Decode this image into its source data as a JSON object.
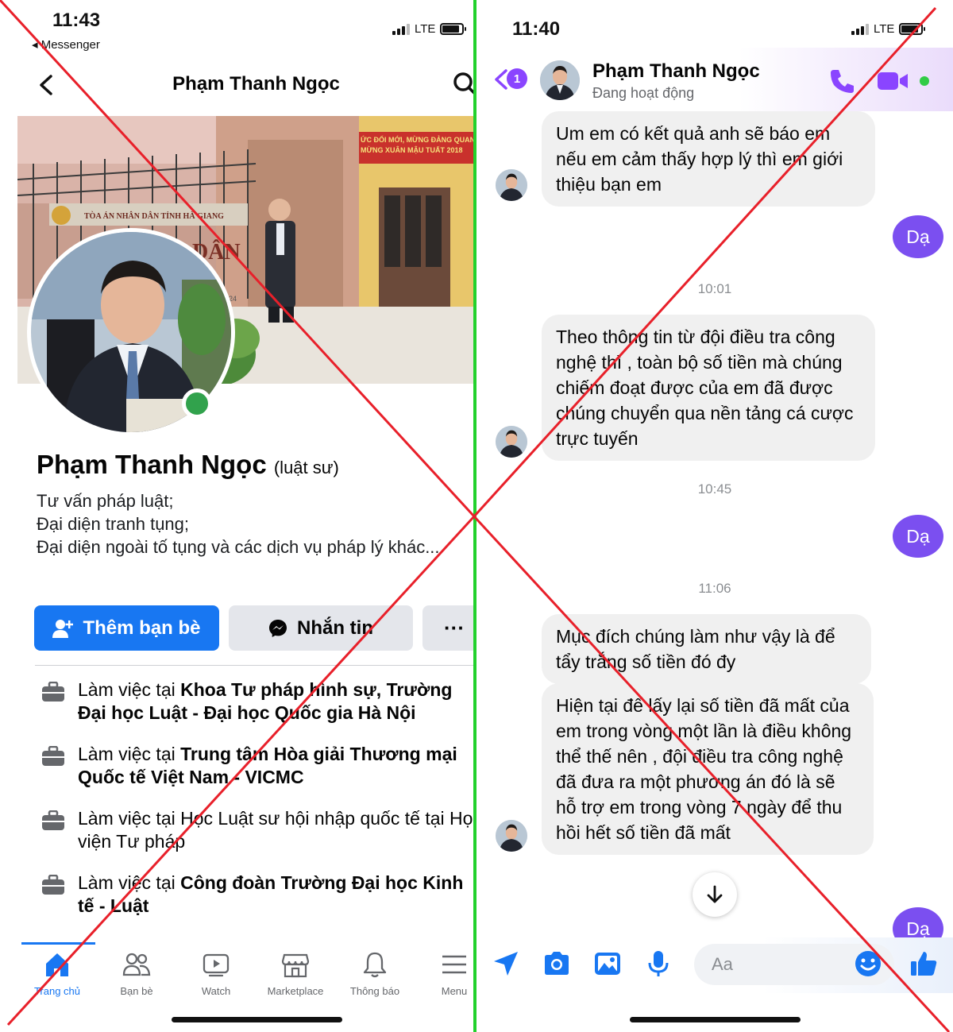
{
  "left_screen": {
    "status": {
      "time": "11:43",
      "back_app": "◂ Messenger",
      "network": "LTE"
    },
    "header": {
      "title": "Phạm Thanh Ngọc"
    },
    "profile": {
      "name": "Phạm Thanh Ngọc",
      "name_tag": "(luật sư)",
      "bio": [
        "Tư vấn pháp luật;",
        "Đại diện tranh tụng;",
        "Đại diện ngoài tố tụng và các dịch vụ pháp lý khác..."
      ]
    },
    "buttons": {
      "add_friend": "Thêm bạn bè",
      "message": "Nhắn tin",
      "more": "···"
    },
    "work": [
      {
        "prefix": "Làm việc tại ",
        "place": "Khoa Tư pháp hình sự, Trường Đại học Luật - Đại học Quốc gia Hà Nội"
      },
      {
        "prefix": "Làm việc tại ",
        "place": "Trung tâm Hòa giải Thương mại Quốc tế Việt Nam - VICMC"
      },
      {
        "prefix": "Làm việc tại Học Luật sư hội nhập quốc tế tại Học viện Tư pháp",
        "place": ""
      },
      {
        "prefix": "Làm việc tại ",
        "place": "Công đoàn Trường Đại học Kinh tế - Luật"
      }
    ],
    "tabs": [
      {
        "label": "Trang chủ",
        "icon": "home-icon",
        "active": true
      },
      {
        "label": "Bạn bè",
        "icon": "friends-icon",
        "active": false
      },
      {
        "label": "Watch",
        "icon": "watch-icon",
        "active": false
      },
      {
        "label": "Marketplace",
        "icon": "marketplace-icon",
        "active": false
      },
      {
        "label": "Thông báo",
        "icon": "bell-icon",
        "active": false
      },
      {
        "label": "Menu",
        "icon": "menu-icon",
        "active": false
      }
    ],
    "accent": "#1877f2",
    "cover_sign": {
      "court": "TÒA ÁN NHÂN DÂN TỈNH HÀ GIANG",
      "banner_line1": "ỨC ĐỔI MỚI, MỪNG ĐẢNG QUANG VI",
      "banner_line2": "MỪNG XUÂN MẬU TUẤT 2018",
      "big_text": "DÂN",
      "plate": "24"
    }
  },
  "right_screen": {
    "status": {
      "time": "11:40",
      "network": "LTE"
    },
    "header": {
      "name": "Phạm Thanh Ngọc",
      "status": "Đang hoạt động",
      "unread_badge": "1"
    },
    "messages": {
      "m1": "Um em có kết quả anh sẽ báo em nếu em cảm thấy hợp lý thì em giới thiệu bạn em",
      "r1": "Dạ",
      "t1": "10:01",
      "m2": "Theo thông tin từ đội điều tra công nghệ thì , toàn bộ số tiền mà chúng chiếm đoạt được của em đã được chúng chuyển qua nền tảng cá cược trực tuyến",
      "t2": "10:45",
      "r2": "Dạ",
      "t3": "11:06",
      "m3": "Mục đích chúng làm như vậy là để tẩy trắng số tiền đó đy",
      "m4": "Hiện tại để lấy lại số tiền đã mất của em trong vòng một lần là điều không thể  thế nên , đội điều tra công nghệ đã đưa ra một phương án đó là sẽ hỗ trợ em trong vòng 7 ngày để thu hồi hết số tiền đã mất",
      "r3": "Dạ"
    },
    "composer_placeholder": "Aa",
    "accent": "#7b4ff0"
  },
  "overlay": {
    "divider_color": "#22d12c",
    "cross_color": "#e8202a"
  }
}
